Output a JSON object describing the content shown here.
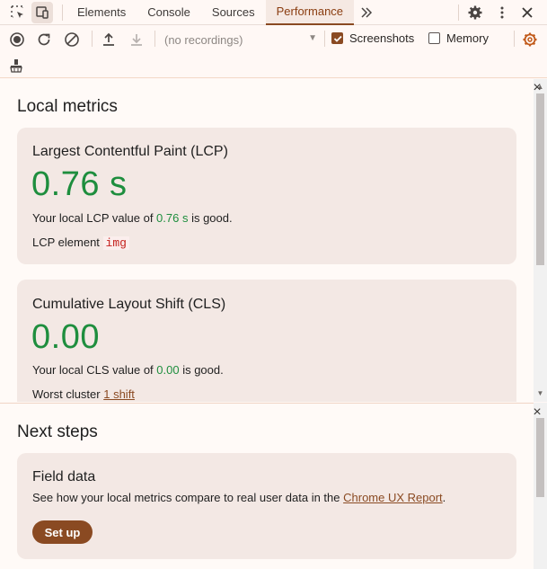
{
  "tabs": [
    {
      "label": "Elements"
    },
    {
      "label": "Console"
    },
    {
      "label": "Sources"
    },
    {
      "label": "Performance"
    }
  ],
  "toolbar": {
    "recordings_placeholder": "(no recordings)",
    "screenshots_label": "Screenshots",
    "screenshots_checked": true,
    "memory_label": "Memory",
    "memory_checked": false
  },
  "local_metrics": {
    "title": "Local metrics",
    "lcp": {
      "title": "Largest Contentful Paint (LCP)",
      "value": "0.76 s",
      "desc_prefix": "Your local LCP value of ",
      "desc_value": "0.76 s",
      "desc_suffix": " is good.",
      "element_label": "LCP element",
      "element_tag": "img"
    },
    "cls": {
      "title": "Cumulative Layout Shift (CLS)",
      "value": "0.00",
      "desc_prefix": "Your local CLS value of ",
      "desc_value": "0.00",
      "desc_suffix": " is good.",
      "cluster_label": "Worst cluster",
      "cluster_link": "1 shift"
    }
  },
  "next_steps": {
    "title": "Next steps",
    "field_data": {
      "title": "Field data",
      "desc_prefix": "See how your local metrics compare to real user data in the ",
      "desc_link": "Chrome UX Report",
      "desc_suffix": ".",
      "button_label": "Set up"
    }
  },
  "colors": {
    "good": "#1e8e3e",
    "accent": "#8a4a22"
  }
}
